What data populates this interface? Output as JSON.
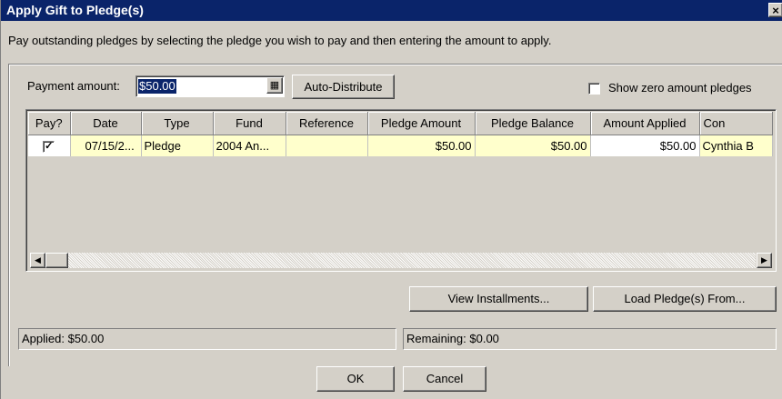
{
  "window": {
    "title": "Apply Gift to Pledge(s)",
    "close_glyph": "×",
    "instructions": "Pay outstanding pledges by selecting the pledge you wish to pay and then entering the amount to apply."
  },
  "payment": {
    "label": "Payment amount:",
    "value": "$50.00",
    "calculator_icon": "calculator-icon",
    "auto_distribute_label": "Auto-Distribute"
  },
  "show_zero": {
    "label": "Show zero amount pledges",
    "checked": false
  },
  "grid": {
    "columns": [
      "Pay?",
      "Date",
      "Type",
      "Fund",
      "Reference",
      "Pledge Amount",
      "Pledge Balance",
      "Amount Applied",
      "Con"
    ],
    "rows": [
      {
        "pay_checked": true,
        "pay_glyph": "✓",
        "date": "07/15/2...",
        "type": "Pledge",
        "fund": "2004 An...",
        "reference": "",
        "pledge_amount": "$50.00",
        "pledge_balance": "$50.00",
        "amount_applied": "$50.00",
        "constituent": "Cynthia B"
      }
    ]
  },
  "scrollbar": {
    "left_arrow": "◀",
    "right_arrow": "▶"
  },
  "buttons": {
    "view_installments": "View Installments...",
    "load_pledges": "Load Pledge(s) From...",
    "ok": "OK",
    "cancel": "Cancel"
  },
  "status": {
    "applied": "Applied:  $50.00",
    "remaining": "Remaining:  $0.00"
  },
  "colors": {
    "titlebar": "#0a246a",
    "face": "#d4d0c8",
    "row_highlight": "#ffffcc"
  }
}
